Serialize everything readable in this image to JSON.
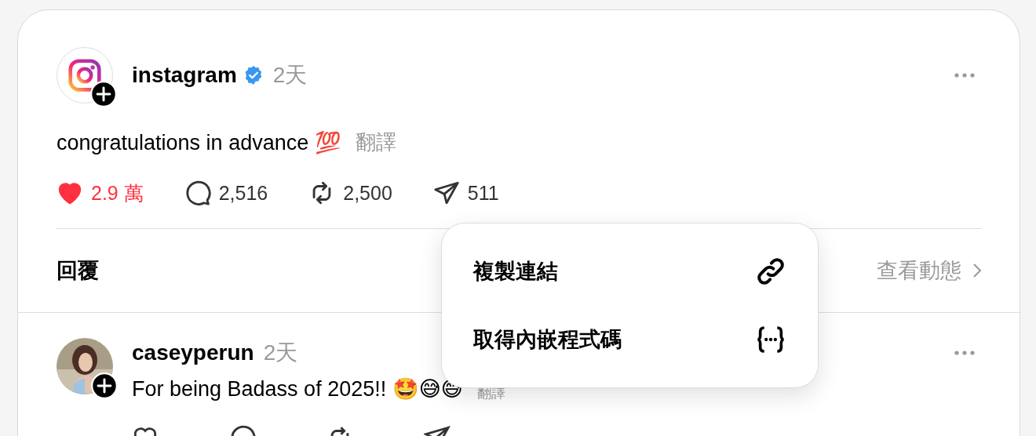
{
  "post": {
    "author": "instagram",
    "verified": true,
    "time": "2天",
    "text": "congratulations in advance 💯",
    "translate": "翻譯",
    "actions": [
      {
        "kind": "like",
        "count": "2.9 萬",
        "selected": true
      },
      {
        "kind": "comment",
        "count": "2,516"
      },
      {
        "kind": "repost",
        "count": "2,500"
      },
      {
        "kind": "share",
        "count": "511"
      }
    ]
  },
  "replies_bar": {
    "label": "回覆",
    "view_activity": "查看動態"
  },
  "reply": {
    "author": "caseyperun",
    "time": "2天",
    "text": "For being Badass of 2025!! 🤩😅😅",
    "translate": "翻譯"
  },
  "menu": {
    "items": [
      {
        "kind": "link",
        "label": "複製連結"
      },
      {
        "kind": "embed",
        "label": "取得內嵌程式碼"
      }
    ]
  }
}
